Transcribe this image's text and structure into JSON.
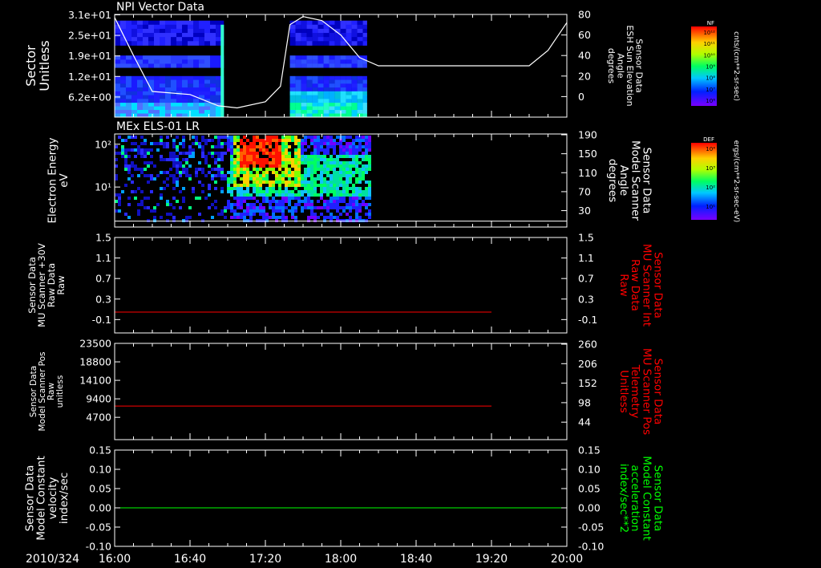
{
  "date_label": "2010/324",
  "time_ticks": [
    "16:00",
    "16:40",
    "17:20",
    "18:00",
    "18:40",
    "19:20",
    "20:00"
  ],
  "colors": {
    "axis": "#ffffff",
    "red_series": "#ff0000",
    "green_series": "#00ff00",
    "right_label_red": "#ff0000",
    "right_label_green": "#00ff00"
  },
  "chart_data": [
    {
      "type": "heatmap",
      "title": "NPI Vector Data",
      "ylabel_lines": [
        "Sector",
        "Unitless"
      ],
      "ytick_labels": [
        "3.1e+01",
        "2.5e+01",
        "1.9e+01",
        "1.2e+01",
        "6.2e+00"
      ],
      "right_axis": {
        "label_lines": [
          "Sensor Data",
          "ESH Sun Elevation",
          "Angle",
          "degrees"
        ],
        "tick_labels": [
          "80",
          "60",
          "40",
          "20",
          "0"
        ],
        "ylim": [
          -20,
          80
        ]
      },
      "colorbar": {
        "label": "NF",
        "units": "cnts/(cm**2-sr-sec)",
        "tick_labels": [
          "10¹²",
          "10¹¹",
          "10¹⁰",
          "10⁹",
          "10⁸",
          "10⁷",
          "10⁶"
        ]
      },
      "data_segments": [
        {
          "start": "16:00",
          "end": "16:58"
        },
        {
          "start": "17:33",
          "end": "18:14"
        }
      ],
      "line_series": {
        "name": "Sun Elevation Angle",
        "x": [
          "16:00",
          "16:10",
          "16:20",
          "16:40",
          "16:55",
          "17:05",
          "17:20",
          "17:28",
          "17:33",
          "17:40",
          "17:50",
          "18:00",
          "18:10",
          "18:20",
          "19:00",
          "19:40",
          "19:50",
          "20:00"
        ],
        "values": [
          77,
          40,
          5,
          2,
          -9,
          -11,
          -5,
          10,
          70,
          78,
          74,
          60,
          38,
          30,
          30,
          30,
          45,
          72
        ]
      }
    },
    {
      "type": "heatmap",
      "title": "MEx ELS-01 LR",
      "ylabel_lines": [
        "Electron Energy",
        "eV"
      ],
      "ytick_labels": [
        "10²",
        "10¹"
      ],
      "right_axis": {
        "label_lines": [
          "Sensor Data",
          "Model Scanner",
          "Angle",
          "degrees"
        ],
        "tick_labels": [
          "190",
          "150",
          "110",
          "70",
          "30"
        ],
        "ylim": [
          0,
          190
        ]
      },
      "colorbar": {
        "label": "DEF",
        "units": "ergs/(cm**2-sr-sec-eV)",
        "tick_labels": [
          "10⁴",
          "10³",
          "10²",
          "10¹"
        ]
      },
      "data_segments": [
        {
          "start": "16:00",
          "end": "18:15"
        }
      ],
      "line_series": {
        "name": "Scanner Angle",
        "x": [
          "16:00",
          "20:00"
        ],
        "values": [
          12,
          12
        ]
      }
    },
    {
      "type": "line",
      "ylabel_lines": [
        "Sensor Data",
        "MU Scanner +30V",
        "Raw Data",
        "Raw"
      ],
      "ytick_labels": [
        "1.5",
        "1.1",
        "0.7",
        "0.3",
        "-0.1"
      ],
      "ylim": [
        -0.42,
        1.5
      ],
      "right_axis": {
        "label_lines": [
          "Sensor Data",
          "MU Scanner Int",
          "Raw Data",
          "Raw"
        ],
        "tick_labels": [
          "1.5",
          "1.1",
          "0.7",
          "0.3",
          "-0.1"
        ],
        "ylim": [
          -0.42,
          1.5
        ],
        "label_color": "red"
      },
      "series": [
        {
          "x": [
            "16:00",
            "19:20"
          ],
          "values": [
            0,
            0
          ],
          "color": "red"
        }
      ]
    },
    {
      "type": "line",
      "ylabel_lines": [
        "Sensor Data",
        "Model Scanner Pos",
        "Raw",
        "unitless"
      ],
      "ytick_labels": [
        "23500",
        "18800",
        "14100",
        "9400",
        "4700"
      ],
      "ylim": [
        0,
        23500
      ],
      "right_axis": {
        "label_lines": [
          "Sensor Data",
          "MU Scanner Pos",
          "Telemetry",
          "Unitless"
        ],
        "tick_labels": [
          "260",
          "206",
          "152",
          "98",
          "44"
        ],
        "ylim": [
          0,
          260
        ],
        "label_color": "red"
      },
      "series": [
        {
          "x": [
            "16:00",
            "19:20"
          ],
          "values": [
            8200,
            8200
          ],
          "color": "red"
        }
      ]
    },
    {
      "type": "line",
      "ylabel_lines": [
        "Sensor Data",
        "Model Constant",
        "velocity",
        "index/sec"
      ],
      "ytick_labels": [
        "0.15",
        "0.10",
        "0.05",
        "0.00",
        "-0.05",
        "-0.10"
      ],
      "ylim": [
        -0.1,
        0.15
      ],
      "right_axis": {
        "label_lines": [
          "Sensor Data",
          "Model Constant",
          "acceleration",
          "index/sec**2"
        ],
        "tick_labels": [
          "0.15",
          "0.10",
          "0.05",
          "0.00",
          "-0.05",
          "-0.10"
        ],
        "ylim": [
          -0.1,
          0.15
        ],
        "label_color": "green"
      },
      "series": [
        {
          "x": [
            "16:00",
            "20:00"
          ],
          "values": [
            0,
            0
          ],
          "color": "green"
        }
      ]
    }
  ]
}
